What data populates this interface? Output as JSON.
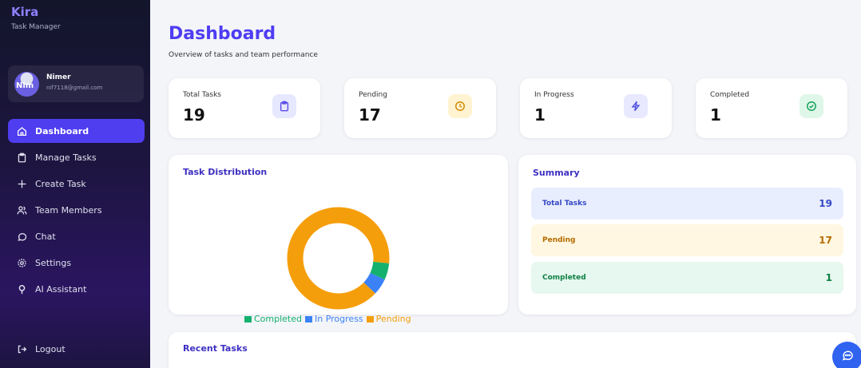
{
  "app": {
    "name": "Kira",
    "subtitle": "Task Manager"
  },
  "user": {
    "avatar_text": "Nim",
    "name": "Nimer",
    "email": "nif7118@gmail.com"
  },
  "nav": [
    {
      "label": "Dashboard",
      "icon": "home-icon",
      "active": true
    },
    {
      "label": "Manage Tasks",
      "icon": "clipboard-icon"
    },
    {
      "label": "Create Task",
      "icon": "plus-icon"
    },
    {
      "label": "Team Members",
      "icon": "users-icon"
    },
    {
      "label": "Chat",
      "icon": "chat-icon"
    },
    {
      "label": "Settings",
      "icon": "gear-icon"
    },
    {
      "label": "AI Assistant",
      "icon": "pin-icon"
    }
  ],
  "logout_label": "Logout",
  "page": {
    "title": "Dashboard",
    "subtitle": "Overview of tasks and team performance"
  },
  "stats": [
    {
      "label": "Total Tasks",
      "value": "19",
      "icon": "clipboard-icon",
      "color": "#5b4ce6",
      "bg": "#e6e8ff"
    },
    {
      "label": "Pending",
      "value": "17",
      "icon": "clock-icon",
      "color": "#d28a00",
      "bg": "#fff3d1"
    },
    {
      "label": "In Progress",
      "value": "1",
      "icon": "bolt-icon",
      "color": "#4e4ee0",
      "bg": "#e8e9ff"
    },
    {
      "label": "Completed",
      "value": "1",
      "icon": "check-circle-icon",
      "color": "#11a05a",
      "bg": "#dff7e8"
    }
  ],
  "distribution": {
    "title": "Task Distribution",
    "segments": [
      {
        "name": "Completed",
        "value": 1,
        "color": "#14b16e"
      },
      {
        "name": "In Progress",
        "value": 1,
        "color": "#3b82f6"
      },
      {
        "name": "Pending",
        "value": 17,
        "color": "#f59e0b"
      }
    ]
  },
  "summary": {
    "title": "Summary",
    "rows": [
      {
        "label": "Total Tasks",
        "value": "19",
        "bg": "#e9eeff",
        "color": "#3448c5"
      },
      {
        "label": "Pending",
        "value": "17",
        "bg": "#fff7e1",
        "color": "#b46b00"
      },
      {
        "label": "Completed",
        "value": "1",
        "bg": "#e6f8ef",
        "color": "#0f7f45"
      }
    ]
  },
  "recent": {
    "title": "Recent Tasks"
  }
}
